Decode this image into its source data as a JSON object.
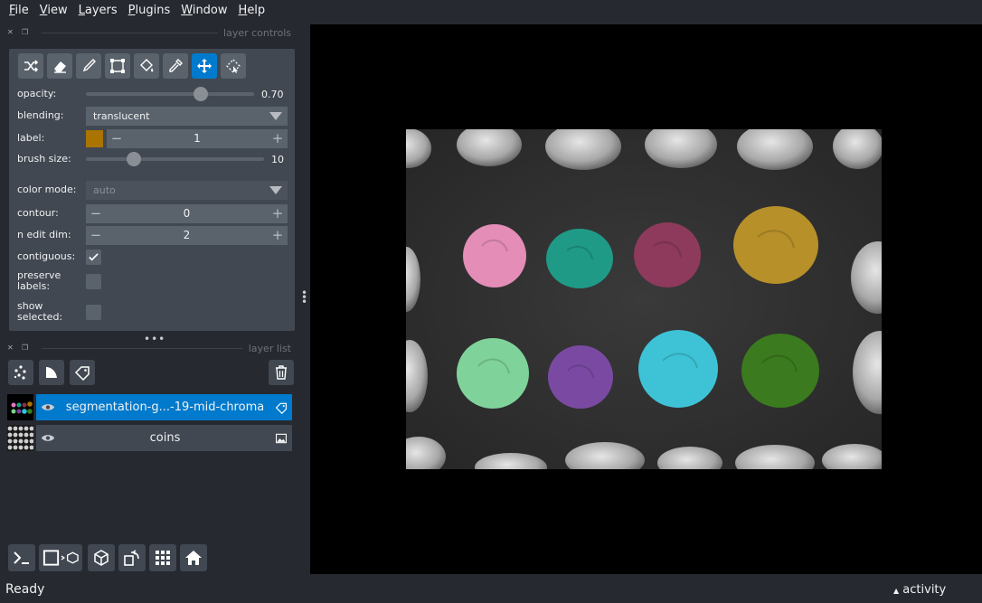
{
  "menu": {
    "items": [
      {
        "label": "File",
        "key": "F",
        "rest": "ile"
      },
      {
        "label": "View",
        "key": "V",
        "rest": "iew"
      },
      {
        "label": "Layers",
        "key": "L",
        "rest": "ayers"
      },
      {
        "label": "Plugins",
        "key": "P",
        "rest": "lugins"
      },
      {
        "label": "Window",
        "key": "W",
        "rest": "indow"
      },
      {
        "label": "Help",
        "key": "H",
        "rest": "elp"
      }
    ]
  },
  "layer_controls": {
    "title": "layer controls",
    "tools": [
      "shuffle-icon",
      "eraser-icon",
      "brush-icon",
      "polygon-icon",
      "fill-bucket-icon",
      "color-picker-icon",
      "move-icon",
      "transform-icon"
    ],
    "active_tool": "move-icon",
    "opacity": {
      "label": "opacity:",
      "value": 0.7,
      "value_text": "0.70"
    },
    "blending": {
      "label": "blending:",
      "value": "translucent"
    },
    "label": {
      "label": "label:",
      "value": "1",
      "color": "#a97400"
    },
    "brush_size": {
      "label": "brush size:",
      "value": 10,
      "value_text": "10",
      "max": 40
    },
    "color_mode": {
      "label": "color mode:",
      "value": "auto"
    },
    "contour": {
      "label": "contour:",
      "value": "0"
    },
    "n_edit_dim": {
      "label": "n edit dim:",
      "value": "2"
    },
    "contiguous": {
      "label": "contiguous:",
      "checked": true
    },
    "preserve_labels": {
      "label_line1": "preserve",
      "label_line2": "labels:",
      "checked": false
    },
    "show_selected": {
      "label_line1": "show",
      "label_line2": "selected:",
      "checked": false
    }
  },
  "layer_list": {
    "title": "layer list",
    "layers": [
      {
        "name": "segmentation-g...-19-mid-chroma",
        "selected": true,
        "type_icon": "label-tag-icon"
      },
      {
        "name": "coins",
        "selected": false,
        "type_icon": "image-icon"
      }
    ]
  },
  "status": {
    "text": "Ready",
    "activity": "activity"
  },
  "colors": {
    "accent": "#007acc",
    "panel": "#414851",
    "background": "#262930"
  }
}
